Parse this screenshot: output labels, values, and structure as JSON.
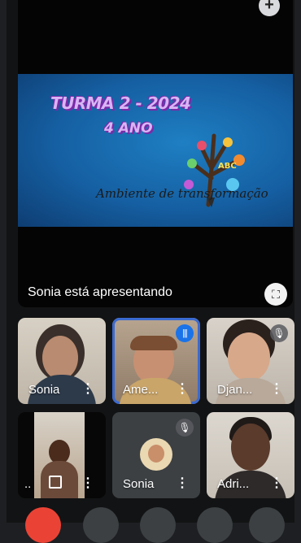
{
  "presentation": {
    "slide": {
      "title": "TURMA 2 - 2024",
      "subtitle": "4 ANO",
      "script_text": "Ambiente de transformação",
      "tree_letters": "ABC"
    },
    "presenting_label": "Sonia está apresentando"
  },
  "participants": [
    {
      "name": "Sonia",
      "status": "normal"
    },
    {
      "name": "Ame...",
      "status": "speaking"
    },
    {
      "name": "Djan...",
      "status": "muted"
    },
    {
      "name": "..",
      "status": "normal"
    },
    {
      "name": "Sonia",
      "status": "muted"
    },
    {
      "name": "Adri...",
      "status": "normal"
    }
  ],
  "icons": {
    "add": "+",
    "fullscreen": "⛶",
    "more": "⋮",
    "mic_off": "🎙",
    "speaking": "|||"
  },
  "colors": {
    "accent": "#1a73e8",
    "end_call": "#ea4335",
    "tile_dark": "#3c4043"
  }
}
